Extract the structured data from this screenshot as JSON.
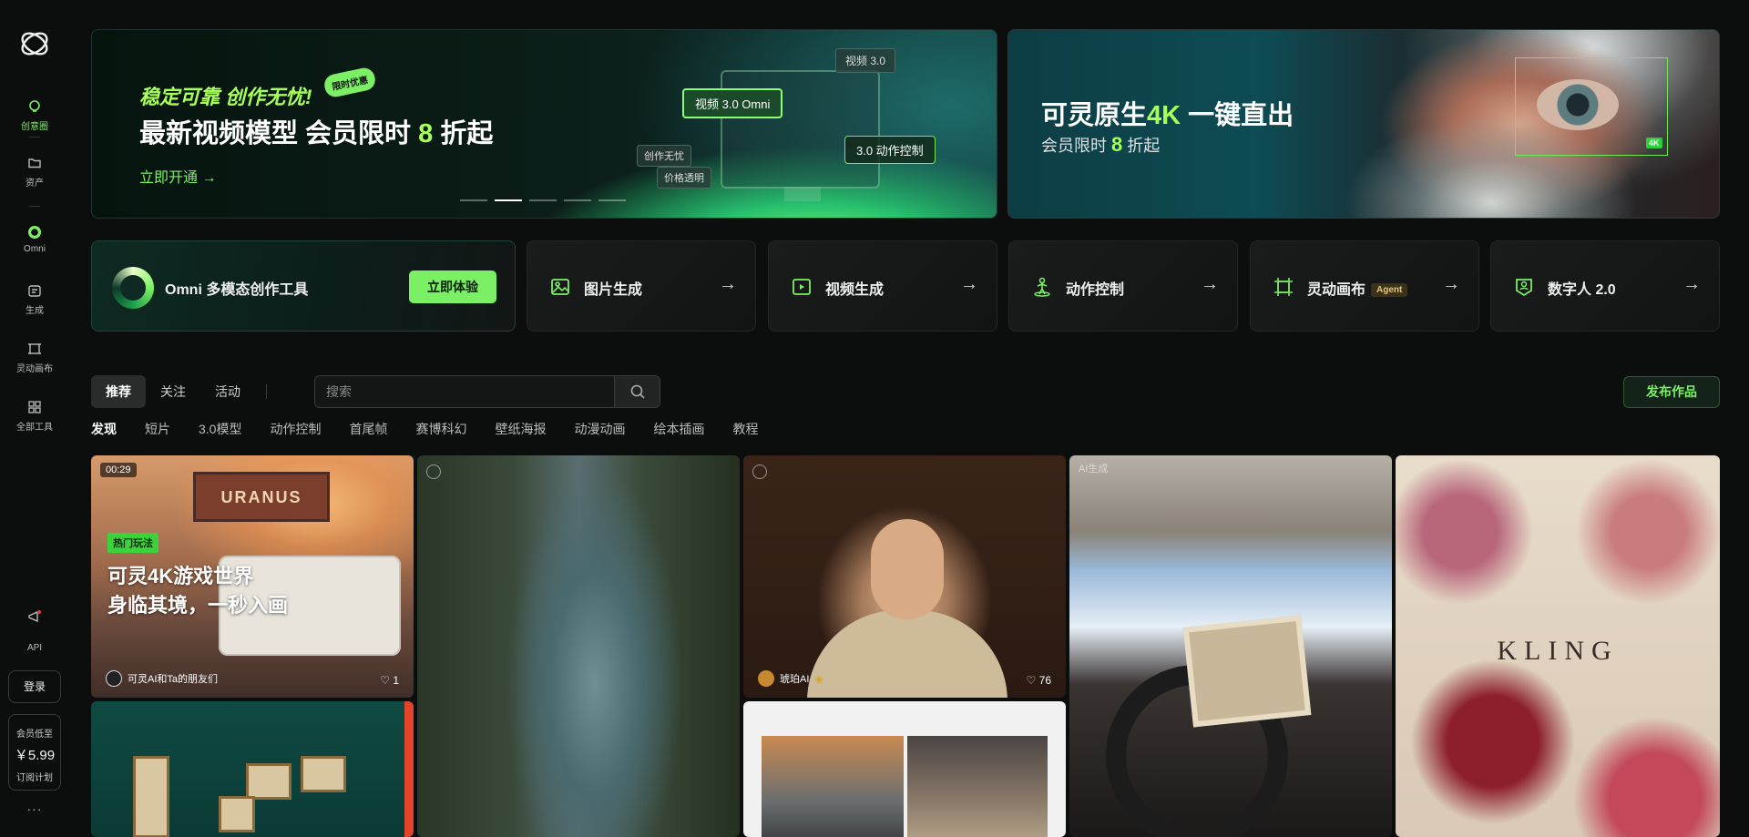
{
  "sidebar": {
    "items": [
      {
        "label": "创意圈"
      },
      {
        "label": "资产"
      },
      {
        "label": "Omni"
      },
      {
        "label": "生成"
      },
      {
        "label": "灵动画布"
      },
      {
        "label": "全部工具"
      }
    ],
    "api_label": "API",
    "login_label": "登录",
    "promo": {
      "line1": "会员低至",
      "price": "￥5.99",
      "line2": "订阅计划"
    },
    "more": "···"
  },
  "banner1": {
    "subtitle": "稳定可靠 创作无忧!",
    "badge": "限时优惠",
    "title_prefix": "最新视频模型 会员限时 ",
    "title_num": "8",
    "title_suffix": " 折起",
    "link": "立即开通 →",
    "tags": {
      "v30": "视频 3.0",
      "omni": "视频 3.0 Omni",
      "motion": "3.0 动作控制",
      "creation": "创作无忧",
      "price": "价格透明"
    }
  },
  "banner2": {
    "title_prefix": "可灵原生",
    "title_hl": "4K",
    "title_suffix": " 一键直出",
    "sub_prefix": "会员限时 ",
    "sub_num": "8",
    "sub_suffix": " 折起",
    "badge": "4K"
  },
  "tools": {
    "omni": {
      "label": "Omni 多模态创作工具",
      "button": "立即体验"
    },
    "image": {
      "label": "图片生成"
    },
    "video": {
      "label": "视频生成"
    },
    "motion": {
      "label": "动作控制"
    },
    "canvas": {
      "label": "灵动画布",
      "tag": "Agent"
    },
    "human": {
      "label": "数字人 2.0"
    },
    "arrow": "→"
  },
  "tabs": [
    {
      "label": "推荐"
    },
    {
      "label": "关注"
    },
    {
      "label": "活动"
    }
  ],
  "search": {
    "placeholder": "搜索"
  },
  "publish_label": "发布作品",
  "categories": [
    "发现",
    "短片",
    "3.0模型",
    "动作控制",
    "首尾帧",
    "赛博科幻",
    "壁纸海报",
    "动漫动画",
    "绘本插画",
    "教程"
  ],
  "feed": [
    {
      "time": "00:29",
      "tag": "热门玩法",
      "title_line1": "可灵4K游戏世界",
      "title_line2": "身临其境，一秒入画",
      "author": "可灵AI和Ta的朋友们",
      "likes": "1",
      "billboard": "URANUS"
    },
    {
      "author": "琥珀AI",
      "likes": "76"
    },
    {
      "watermark": "AI生成"
    },
    {
      "brand": "KLING"
    }
  ]
}
